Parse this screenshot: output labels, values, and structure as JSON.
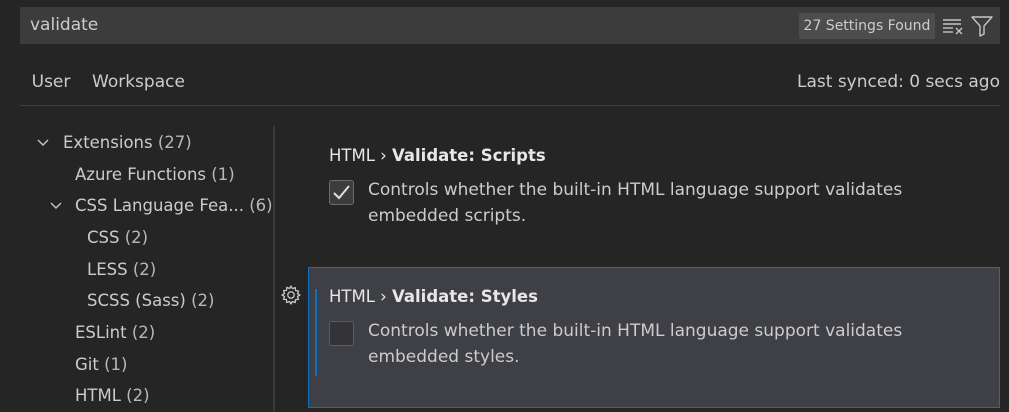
{
  "search": {
    "value": "validate",
    "result_count": "27 Settings Found",
    "icons": [
      "clear-filter-icon",
      "filter-icon"
    ]
  },
  "tabs": [
    {
      "label": "User",
      "active": true
    },
    {
      "label": "Workspace",
      "active": false
    }
  ],
  "sync_status": "Last synced: 0 secs ago",
  "toc": {
    "items": [
      {
        "label": "Extensions",
        "count": "(27)",
        "expanded": true
      },
      {
        "label": "Azure Functions",
        "count": "(1)"
      },
      {
        "label": "CSS Language Fea...",
        "count": "(6)",
        "expanded": true
      },
      {
        "label": "CSS",
        "count": "(2)"
      },
      {
        "label": "LESS",
        "count": "(2)"
      },
      {
        "label": "SCSS (Sass)",
        "count": "(2)"
      },
      {
        "label": "ESLint",
        "count": "(2)"
      },
      {
        "label": "Git",
        "count": "(1)"
      },
      {
        "label": "HTML",
        "count": "(2)"
      }
    ]
  },
  "settings": [
    {
      "category": "HTML › ",
      "key": "Validate: Scripts",
      "checked": true,
      "description": "Controls whether the built-in HTML language support validates embedded scripts."
    },
    {
      "category": "HTML › ",
      "key": "Validate: Styles",
      "checked": false,
      "description": "Controls whether the built-in HTML language support validates embedded styles."
    }
  ],
  "colors": {
    "background": "#252526",
    "focus_border": "#0e70c0",
    "focused_row": "#3f4046",
    "input_background": "#3c3c3c"
  }
}
